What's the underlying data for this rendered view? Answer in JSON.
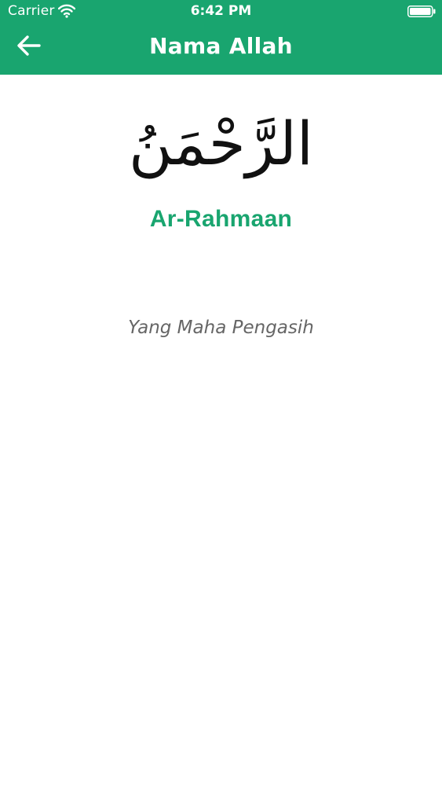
{
  "status_bar": {
    "carrier": "Carrier",
    "time": "6:42 PM",
    "icons": [
      "wifi-icon",
      "battery-icon"
    ]
  },
  "nav_bar": {
    "title": "Nama Allah",
    "back_icon": "arrow-left-icon"
  },
  "content": {
    "arabic_name": "الرَّحْمَنُ",
    "latin_name": "Ar-Rahmaan",
    "meaning": "Yang Maha Pengasih"
  },
  "colors": {
    "primary": "#19a56f",
    "background": "#ffffff",
    "arabic_text": "#111111",
    "meaning_text": "#666666"
  }
}
